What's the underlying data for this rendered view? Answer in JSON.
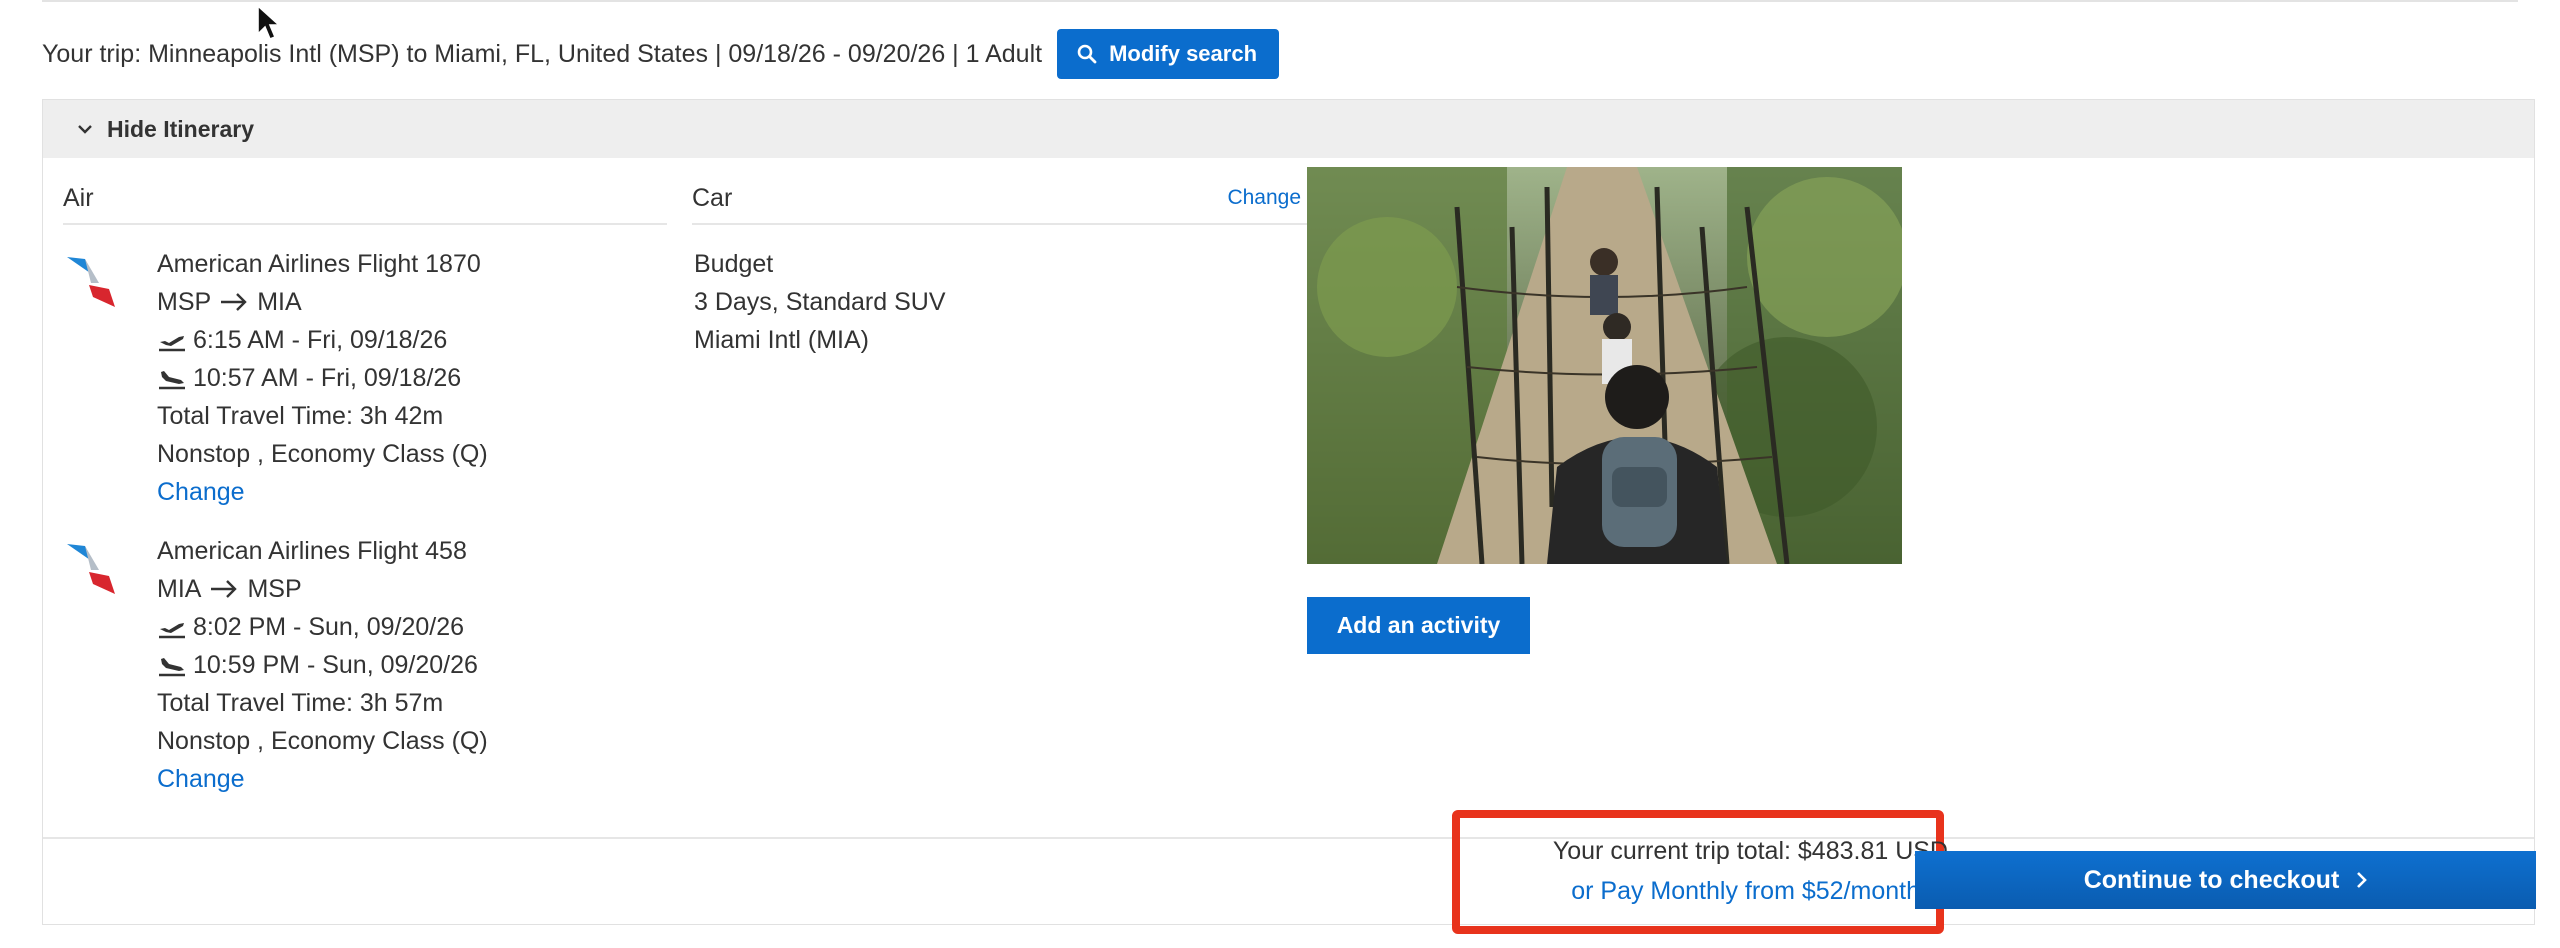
{
  "trip_bar": {
    "summary": "Your trip: Minneapolis Intl (MSP) to Miami, FL, United States | 09/18/26 - 09/20/26 | 1 Adult",
    "modify_label": "Modify search"
  },
  "itinerary": {
    "toggle_label": "Hide Itinerary",
    "air": {
      "heading": "Air",
      "flights": [
        {
          "name": "American Airlines Flight 1870",
          "route_from": "MSP",
          "route_to": "MIA",
          "depart": "6:15 AM - Fri, 09/18/26",
          "arrive": "10:57 AM - Fri, 09/18/26",
          "travel_time": "Total Travel Time: 3h 42m",
          "class": "Nonstop , Economy Class (Q)",
          "change_label": "Change"
        },
        {
          "name": "American Airlines Flight 458",
          "route_from": "MIA",
          "route_to": "MSP",
          "depart": "8:02 PM - Sun, 09/20/26",
          "arrive": "10:59 PM - Sun, 09/20/26",
          "travel_time": "Total Travel Time: 3h 57m",
          "class": "Nonstop , Economy Class (Q)",
          "change_label": "Change"
        }
      ]
    },
    "car": {
      "heading": "Car",
      "change_label": "Change",
      "company": "Budget",
      "details": "3 Days, Standard SUV",
      "location": "Miami Intl (MIA)"
    },
    "activity": {
      "add_label": "Add an activity"
    }
  },
  "footer": {
    "total": "Your current trip total: $483.81 USD",
    "monthly": "or Pay Monthly from $52/month",
    "checkout_label": "Continue to checkout"
  },
  "colors": {
    "accent": "#0b6dcd",
    "highlight": "#e8331c",
    "header_bg": "#eeeeee"
  }
}
